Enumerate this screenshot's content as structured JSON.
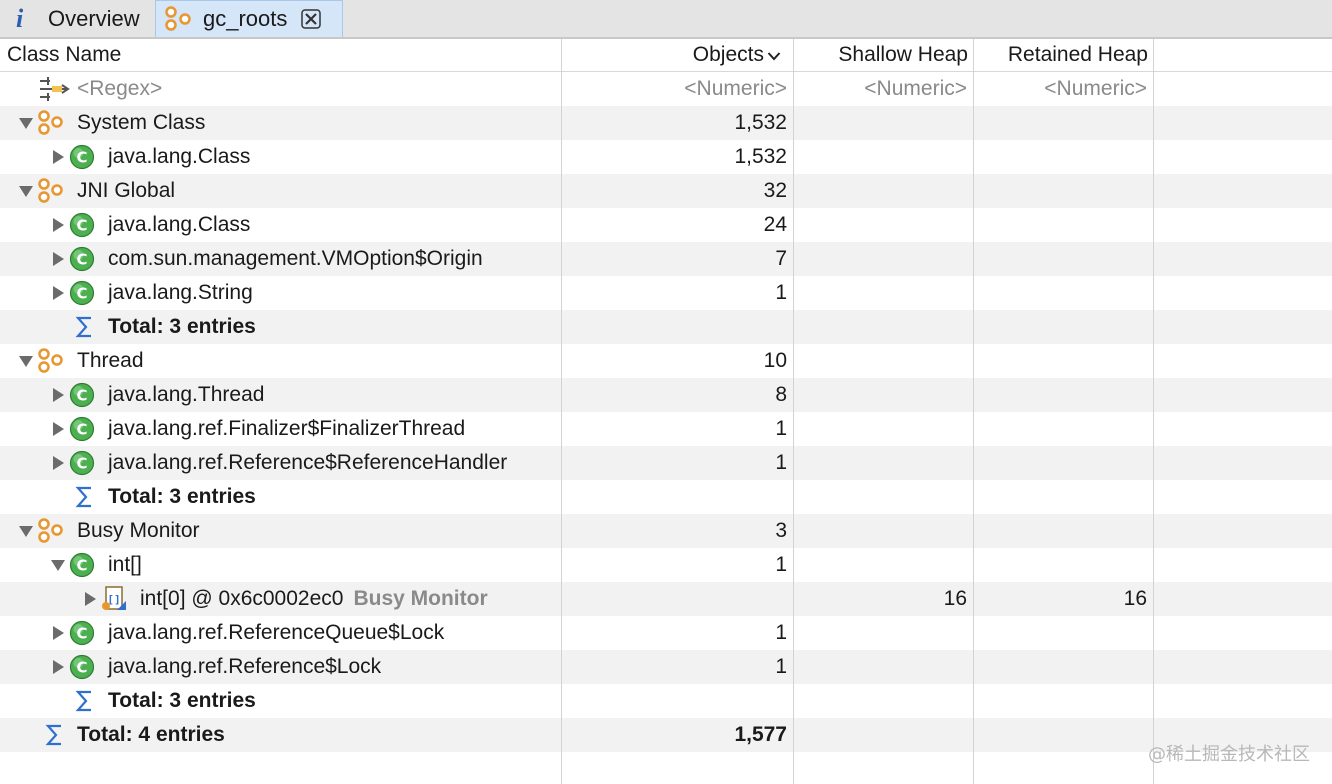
{
  "tabs": [
    {
      "label": "Overview",
      "icon": "info-icon"
    },
    {
      "label": "gc_roots",
      "icon": "gc-roots-icon"
    }
  ],
  "columns": {
    "class_name": "Class Name",
    "objects": "Objects",
    "shallow_heap": "Shallow Heap",
    "retained_heap": "Retained Heap"
  },
  "filter_row": {
    "class_name": "<Regex>",
    "objects": "<Numeric>",
    "shallow_heap": "<Numeric>",
    "retained_heap": "<Numeric>"
  },
  "rows": [
    {
      "name": "System Class",
      "objects": "1,532",
      "shallow": "",
      "retained": ""
    },
    {
      "name": "java.lang.Class",
      "objects": "1,532",
      "shallow": "",
      "retained": ""
    },
    {
      "name": "JNI Global",
      "objects": "32",
      "shallow": "",
      "retained": ""
    },
    {
      "name": "java.lang.Class",
      "objects": "24",
      "shallow": "",
      "retained": ""
    },
    {
      "name": "com.sun.management.VMOption$Origin",
      "objects": "7",
      "shallow": "",
      "retained": ""
    },
    {
      "name": "java.lang.String",
      "objects": "1",
      "shallow": "",
      "retained": ""
    },
    {
      "name": "Total: 3 entries",
      "objects": "",
      "shallow": "",
      "retained": ""
    },
    {
      "name": "Thread",
      "objects": "10",
      "shallow": "",
      "retained": ""
    },
    {
      "name": "java.lang.Thread",
      "objects": "8",
      "shallow": "",
      "retained": ""
    },
    {
      "name": "java.lang.ref.Finalizer$FinalizerThread",
      "objects": "1",
      "shallow": "",
      "retained": ""
    },
    {
      "name": "java.lang.ref.Reference$ReferenceHandler",
      "objects": "1",
      "shallow": "",
      "retained": ""
    },
    {
      "name": "Total: 3 entries",
      "objects": "",
      "shallow": "",
      "retained": ""
    },
    {
      "name": "Busy Monitor",
      "objects": "3",
      "shallow": "",
      "retained": ""
    },
    {
      "name": "int[]",
      "objects": "1",
      "shallow": "",
      "retained": ""
    },
    {
      "name": "int[0] @ 0x6c0002ec0",
      "tag": "Busy Monitor",
      "objects": "",
      "shallow": "16",
      "retained": "16"
    },
    {
      "name": "java.lang.ref.ReferenceQueue$Lock",
      "objects": "1",
      "shallow": "",
      "retained": ""
    },
    {
      "name": "java.lang.ref.Reference$Lock",
      "objects": "1",
      "shallow": "",
      "retained": ""
    },
    {
      "name": "Total: 3 entries",
      "objects": "",
      "shallow": "",
      "retained": ""
    },
    {
      "name": "Total: 4 entries",
      "objects": "1,577",
      "shallow": "",
      "retained": ""
    }
  ],
  "watermark": "@稀土掘金技术社区",
  "colors": {
    "active_tab": "#d4e6f8",
    "class_icon": "#4caf50",
    "gc_root_icon": "#e8962e",
    "row_shade": "#f2f2f2"
  }
}
